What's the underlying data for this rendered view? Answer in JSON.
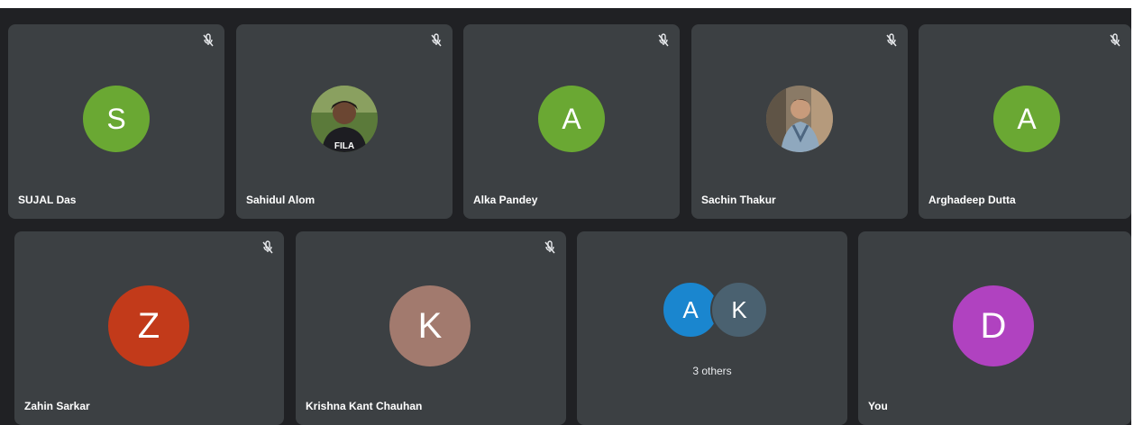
{
  "participants_row1": [
    {
      "name": "SUJAL Das",
      "initial": "S",
      "color": "#6aa833"
    },
    {
      "name": "Sahidul Alom",
      "initial": "",
      "photo": true
    },
    {
      "name": "Alka Pandey",
      "initial": "A",
      "color": "#6aa833"
    },
    {
      "name": "Sachin Thakur",
      "initial": "",
      "photo": true
    },
    {
      "name": "Arghadeep Dutta",
      "initial": "A",
      "color": "#6aa833"
    }
  ],
  "participants_row2": [
    {
      "name": "Zahin Sarkar",
      "initial": "Z",
      "color": "#c23a1a"
    },
    {
      "name": "Krishna Kant Chauhan",
      "initial": "K",
      "color": "#a27a6e"
    }
  ],
  "others": {
    "avatars": [
      {
        "initial": "A",
        "color": "#1a86cf"
      },
      {
        "initial": "K",
        "color": "#4a6170"
      }
    ],
    "label": "3 others"
  },
  "self": {
    "name": "You",
    "initial": "D",
    "color": "#b042c0"
  },
  "icons": {
    "muted": "mic-off-icon"
  }
}
